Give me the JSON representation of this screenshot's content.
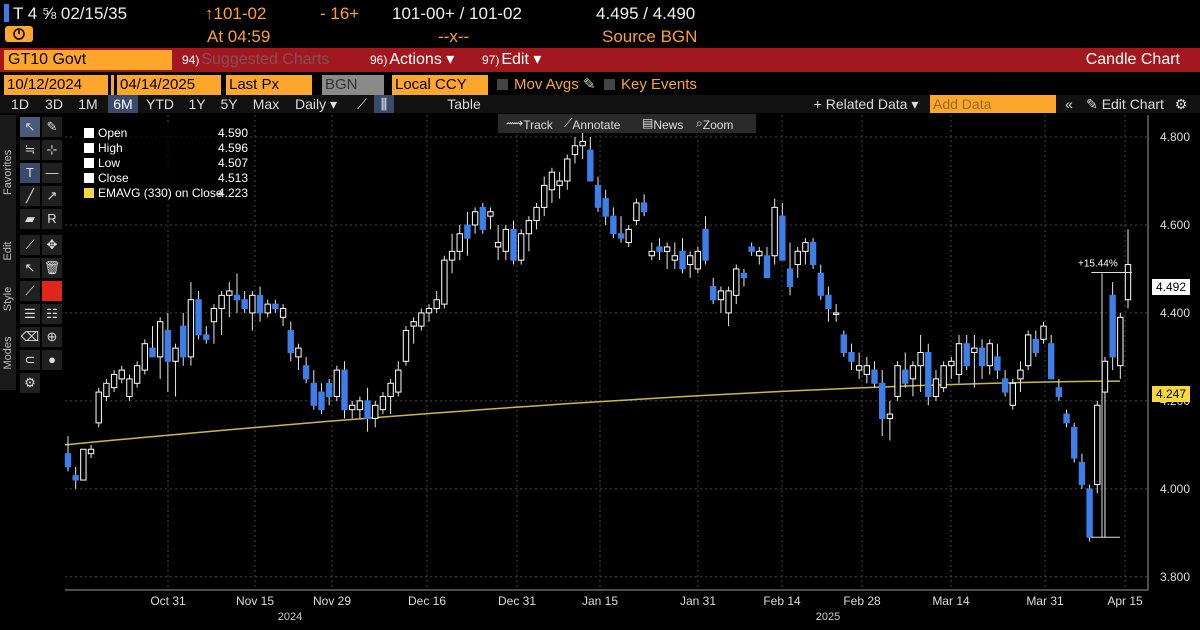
{
  "quote": {
    "security": "T 4 ⅝ 02/15/35",
    "last": "↑101-02",
    "change": "- 16+",
    "bid_ask": "101-00+ / 101-02",
    "yields": "4.495 / 4.490",
    "time": "At 04:59",
    "mid": "--x--",
    "source": "Source BGN"
  },
  "menu": {
    "ticker": "GT10 Govt",
    "suggested": "Suggested Charts",
    "suggested_num": "94)",
    "actions": "Actions ▾",
    "actions_num": "96)",
    "edit": "Edit ▾",
    "edit_num": "97)",
    "title": "Candle Chart"
  },
  "controls": {
    "start_date": "10/12/2024",
    "end_date": "04/14/2025",
    "field": "Last Px",
    "source": "BGN",
    "currency": "Local CCY",
    "mov_avgs": "Mov Avgs",
    "key_events": "Key Events",
    "ranges": [
      "1D",
      "3D",
      "1M",
      "6M",
      "YTD",
      "1Y",
      "5Y",
      "Max"
    ],
    "active_range": "6M",
    "period": "Daily ▾",
    "table": "Table",
    "related_data": "+ Related Data ▾",
    "add_data_placeholder": "Add Data",
    "edit_chart": "Edit Chart"
  },
  "toolbar": {
    "favorites": "Favorites",
    "edit": "Edit",
    "style": "Style",
    "modes": "Modes"
  },
  "chart_tools": {
    "track": "Track",
    "annotate": "Annotate",
    "news": "News",
    "zoom": "Zoom"
  },
  "legend": {
    "open_label": "Open",
    "open": "4.590",
    "high_label": "High",
    "high": "4.596",
    "low_label": "Low",
    "low": "4.507",
    "close_label": "Close",
    "close": "4.513",
    "ema_label": "EMAVG (330)  on Close",
    "ema": "4.223"
  },
  "colors": {
    "up": "#ffffff",
    "down": "#3d7ee8",
    "ema": "#c8b84a",
    "last_tag": "#ffffff",
    "ema_tag": "#f5d840"
  },
  "annotation": "+15.44%",
  "last_price_tag": "4.492",
  "ema_price_tag": "4.247",
  "chart_data": {
    "type": "candlestick",
    "title": "",
    "ylim": [
      3.77,
      4.85
    ],
    "y_ticks": [
      "3.800",
      "4.000",
      "4.200",
      "4.400",
      "4.600",
      "4.800"
    ],
    "x_ticks": [
      "Oct 31",
      "Nov 15",
      "Nov 29",
      "Dec 16",
      "Dec 31",
      "Jan 15",
      "Jan 31",
      "Feb 14",
      "Feb 28",
      "Mar 14",
      "Mar 31",
      "Apr 15"
    ],
    "x_years": [
      "2024",
      "2025"
    ],
    "series": [
      {
        "name": "GT10 Govt",
        "ohlc": [
          [
            4.08,
            4.12,
            4.04,
            4.05
          ],
          [
            4.03,
            4.05,
            4.0,
            4.02
          ],
          [
            4.02,
            4.09,
            4.02,
            4.09
          ],
          [
            4.08,
            4.1,
            4.07,
            4.09
          ],
          [
            4.15,
            4.23,
            4.14,
            4.22
          ],
          [
            4.21,
            4.25,
            4.2,
            4.24
          ],
          [
            4.23,
            4.27,
            4.22,
            4.26
          ],
          [
            4.25,
            4.28,
            4.24,
            4.27
          ],
          [
            4.21,
            4.26,
            4.2,
            4.25
          ],
          [
            4.24,
            4.29,
            4.23,
            4.28
          ],
          [
            4.27,
            4.34,
            4.26,
            4.33
          ],
          [
            4.32,
            4.37,
            4.3,
            4.3
          ],
          [
            4.3,
            4.39,
            4.25,
            4.38
          ],
          [
            4.36,
            4.4,
            4.22,
            4.29
          ],
          [
            4.29,
            4.33,
            4.21,
            4.32
          ],
          [
            4.37,
            4.4,
            4.28,
            4.3
          ],
          [
            4.3,
            4.47,
            4.28,
            4.43
          ],
          [
            4.43,
            4.45,
            4.34,
            4.35
          ],
          [
            4.35,
            4.37,
            4.33,
            4.34
          ],
          [
            4.38,
            4.42,
            4.33,
            4.41
          ],
          [
            4.41,
            4.45,
            4.35,
            4.44
          ],
          [
            4.44,
            4.47,
            4.39,
            4.45
          ],
          [
            4.44,
            4.49,
            4.4,
            4.43
          ],
          [
            4.43,
            4.45,
            4.4,
            4.41
          ],
          [
            4.4,
            4.45,
            4.36,
            4.44
          ],
          [
            4.44,
            4.46,
            4.38,
            4.4
          ],
          [
            4.4,
            4.43,
            4.39,
            4.42
          ],
          [
            4.42,
            4.43,
            4.4,
            4.41
          ],
          [
            4.39,
            4.42,
            4.37,
            4.41
          ],
          [
            4.36,
            4.38,
            4.29,
            4.31
          ],
          [
            4.3,
            4.33,
            4.27,
            4.32
          ],
          [
            4.28,
            4.3,
            4.24,
            4.25
          ],
          [
            4.24,
            4.27,
            4.18,
            4.19
          ],
          [
            4.22,
            4.24,
            4.17,
            4.18
          ],
          [
            4.24,
            4.25,
            4.19,
            4.21
          ],
          [
            4.21,
            4.28,
            4.2,
            4.27
          ],
          [
            4.27,
            4.29,
            4.16,
            4.18
          ],
          [
            4.18,
            4.2,
            4.16,
            4.19
          ],
          [
            4.18,
            4.21,
            4.16,
            4.2
          ],
          [
            4.2,
            4.23,
            4.13,
            4.16
          ],
          [
            4.16,
            4.2,
            4.14,
            4.19
          ],
          [
            4.18,
            4.22,
            4.17,
            4.21
          ],
          [
            4.21,
            4.25,
            4.17,
            4.24
          ],
          [
            4.22,
            4.29,
            4.21,
            4.27
          ],
          [
            4.29,
            4.37,
            4.28,
            4.36
          ],
          [
            4.37,
            4.39,
            4.33,
            4.38
          ],
          [
            4.37,
            4.41,
            4.36,
            4.4
          ],
          [
            4.4,
            4.42,
            4.38,
            4.41
          ],
          [
            4.41,
            4.45,
            4.4,
            4.43
          ],
          [
            4.42,
            4.53,
            4.41,
            4.52
          ],
          [
            4.52,
            4.58,
            4.49,
            4.54
          ],
          [
            4.54,
            4.6,
            4.52,
            4.58
          ],
          [
            4.6,
            4.63,
            4.53,
            4.57
          ],
          [
            4.6,
            4.64,
            4.58,
            4.63
          ],
          [
            4.64,
            4.65,
            4.58,
            4.59
          ],
          [
            4.62,
            4.64,
            4.59,
            4.63
          ],
          [
            4.55,
            4.6,
            4.52,
            4.56
          ],
          [
            4.54,
            4.6,
            4.52,
            4.59
          ],
          [
            4.59,
            4.61,
            4.51,
            4.52
          ],
          [
            4.52,
            4.59,
            4.51,
            4.58
          ],
          [
            4.58,
            4.62,
            4.54,
            4.61
          ],
          [
            4.61,
            4.65,
            4.59,
            4.64
          ],
          [
            4.64,
            4.71,
            4.62,
            4.69
          ],
          [
            4.68,
            4.73,
            4.65,
            4.72
          ],
          [
            4.69,
            4.72,
            4.66,
            4.7
          ],
          [
            4.7,
            4.76,
            4.68,
            4.75
          ],
          [
            4.76,
            4.8,
            4.74,
            4.78
          ],
          [
            4.78,
            4.81,
            4.75,
            4.79
          ],
          [
            4.77,
            4.8,
            4.7,
            4.7
          ],
          [
            4.69,
            4.71,
            4.63,
            4.64
          ],
          [
            4.66,
            4.68,
            4.6,
            4.62
          ],
          [
            4.62,
            4.64,
            4.57,
            4.58
          ],
          [
            4.58,
            4.62,
            4.56,
            4.57
          ],
          [
            4.56,
            4.6,
            4.55,
            4.59
          ],
          [
            4.61,
            4.66,
            4.6,
            4.65
          ],
          [
            4.65,
            4.67,
            4.62,
            4.63
          ],
          [
            4.53,
            4.56,
            4.52,
            4.54
          ],
          [
            4.55,
            4.57,
            4.52,
            4.54
          ],
          [
            4.54,
            4.56,
            4.5,
            4.55
          ],
          [
            4.52,
            4.56,
            4.5,
            4.53
          ],
          [
            4.54,
            4.57,
            4.49,
            4.5
          ],
          [
            4.51,
            4.54,
            4.48,
            4.53
          ],
          [
            4.5,
            4.55,
            4.49,
            4.54
          ],
          [
            4.59,
            4.62,
            4.51,
            4.52
          ],
          [
            4.46,
            4.48,
            4.42,
            4.43
          ],
          [
            4.43,
            4.46,
            4.4,
            4.45
          ],
          [
            4.4,
            4.46,
            4.37,
            4.45
          ],
          [
            4.44,
            4.51,
            4.42,
            4.5
          ],
          [
            4.49,
            4.5,
            4.46,
            4.48
          ],
          [
            4.55,
            4.56,
            4.53,
            4.54
          ],
          [
            4.53,
            4.55,
            4.51,
            4.54
          ],
          [
            4.53,
            4.55,
            4.48,
            4.48
          ],
          [
            4.53,
            4.66,
            4.51,
            4.64
          ],
          [
            4.62,
            4.65,
            4.52,
            4.52
          ],
          [
            4.5,
            4.56,
            4.44,
            4.46
          ],
          [
            4.51,
            4.55,
            4.48,
            4.54
          ],
          [
            4.54,
            4.57,
            4.51,
            4.56
          ],
          [
            4.56,
            4.57,
            4.5,
            4.51
          ],
          [
            4.49,
            4.51,
            4.43,
            4.44
          ],
          [
            4.44,
            4.46,
            4.38,
            4.41
          ],
          [
            4.4,
            4.42,
            4.38,
            4.4
          ],
          [
            4.35,
            4.36,
            4.3,
            4.31
          ],
          [
            4.31,
            4.33,
            4.27,
            4.29
          ],
          [
            4.27,
            4.31,
            4.25,
            4.28
          ],
          [
            4.26,
            4.3,
            4.24,
            4.28
          ],
          [
            4.27,
            4.29,
            4.23,
            4.24
          ],
          [
            4.24,
            4.27,
            4.12,
            4.16
          ],
          [
            4.16,
            4.2,
            4.11,
            4.17
          ],
          [
            4.21,
            4.29,
            4.2,
            4.28
          ],
          [
            4.27,
            4.31,
            4.23,
            4.24
          ],
          [
            4.25,
            4.29,
            4.21,
            4.28
          ],
          [
            4.28,
            4.35,
            4.22,
            4.31
          ],
          [
            4.31,
            4.33,
            4.19,
            4.21
          ],
          [
            4.21,
            4.27,
            4.2,
            4.25
          ],
          [
            4.23,
            4.29,
            4.22,
            4.28
          ],
          [
            4.28,
            4.3,
            4.25,
            4.29
          ],
          [
            4.26,
            4.35,
            4.24,
            4.33
          ],
          [
            4.33,
            4.35,
            4.27,
            4.28
          ],
          [
            4.31,
            4.35,
            4.23,
            4.32
          ],
          [
            4.32,
            4.34,
            4.25,
            4.28
          ],
          [
            4.28,
            4.34,
            4.26,
            4.33
          ],
          [
            4.3,
            4.33,
            4.25,
            4.27
          ],
          [
            4.25,
            4.27,
            4.21,
            4.22
          ],
          [
            4.19,
            4.25,
            4.18,
            4.24
          ],
          [
            4.25,
            4.29,
            4.22,
            4.27
          ],
          [
            4.28,
            4.36,
            4.27,
            4.35
          ],
          [
            4.34,
            4.36,
            4.3,
            4.31
          ],
          [
            4.34,
            4.38,
            4.33,
            4.37
          ],
          [
            4.33,
            4.35,
            4.25,
            4.25
          ],
          [
            4.23,
            4.25,
            4.2,
            4.21
          ],
          [
            4.17,
            4.18,
            4.14,
            4.15
          ],
          [
            4.14,
            4.15,
            4.06,
            4.07
          ],
          [
            4.06,
            4.08,
            4.0,
            4.01
          ],
          [
            4.0,
            4.01,
            3.88,
            3.89
          ],
          [
            4.01,
            4.2,
            3.99,
            4.19
          ],
          [
            4.22,
            4.3,
            3.89,
            4.29
          ],
          [
            4.44,
            4.47,
            4.27,
            4.3
          ],
          [
            4.28,
            4.4,
            4.25,
            4.39
          ],
          [
            4.43,
            4.59,
            4.41,
            4.51
          ]
        ]
      },
      {
        "name": "EMAVG (330)",
        "from": 4.1,
        "to": 4.245
      }
    ]
  }
}
